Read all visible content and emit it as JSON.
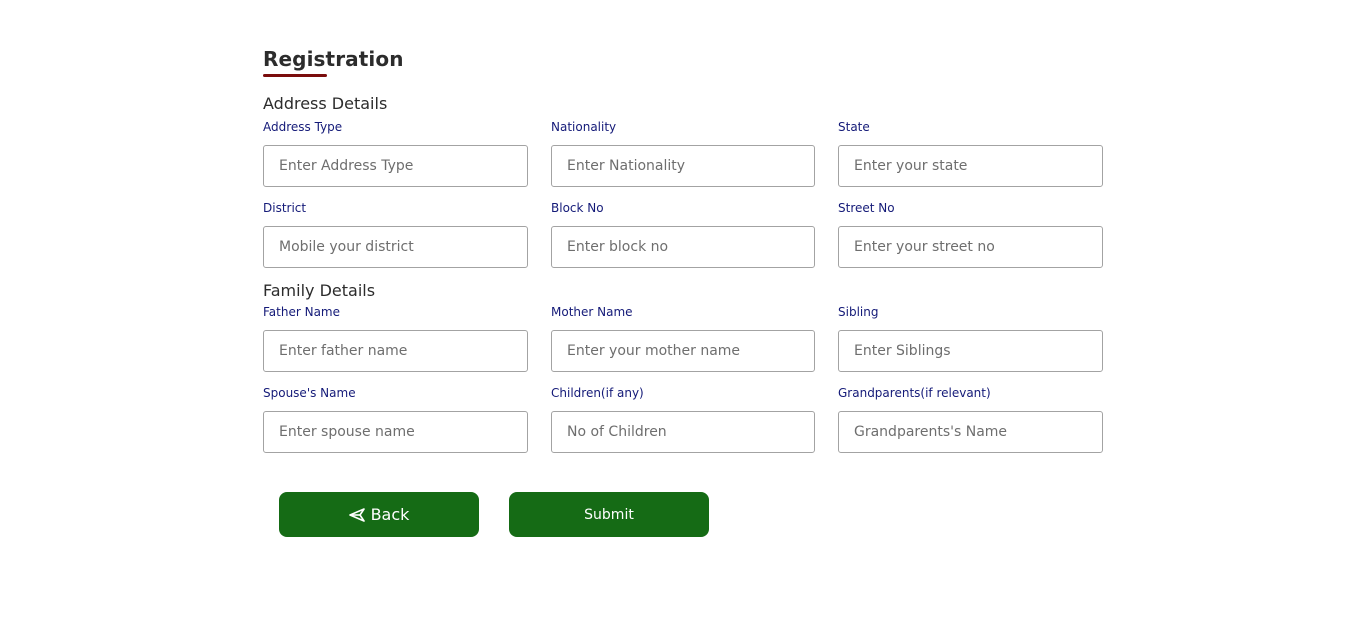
{
  "form": {
    "title": "Registration"
  },
  "address": {
    "heading": "Address Details",
    "fields": [
      {
        "label": "Address Type",
        "placeholder": "Enter Address Type"
      },
      {
        "label": "Nationality",
        "placeholder": "Enter Nationality"
      },
      {
        "label": "State",
        "placeholder": "Enter your state"
      },
      {
        "label": "District",
        "placeholder": "Mobile your district"
      },
      {
        "label": "Block No",
        "placeholder": "Enter block no"
      },
      {
        "label": "Street No",
        "placeholder": "Enter your street no"
      }
    ]
  },
  "family": {
    "heading": "Family Details",
    "fields": [
      {
        "label": "Father Name",
        "placeholder": "Enter father name"
      },
      {
        "label": "Mother Name",
        "placeholder": "Enter your mother name"
      },
      {
        "label": "Sibling",
        "placeholder": "Enter Siblings"
      },
      {
        "label": "Spouse's Name",
        "placeholder": "Enter spouse name"
      },
      {
        "label": "Children(if any)",
        "placeholder": "No of Children"
      },
      {
        "label": "Grandparents(if relevant)",
        "placeholder": "Grandparents's Name"
      }
    ]
  },
  "actions": {
    "back_label": "Back",
    "back_icon": "send-back-icon",
    "submit_label": "Submit"
  },
  "colors": {
    "accent_green": "#156b15",
    "title_underline": "#7a0c0c",
    "label_navy": "#141a78"
  }
}
